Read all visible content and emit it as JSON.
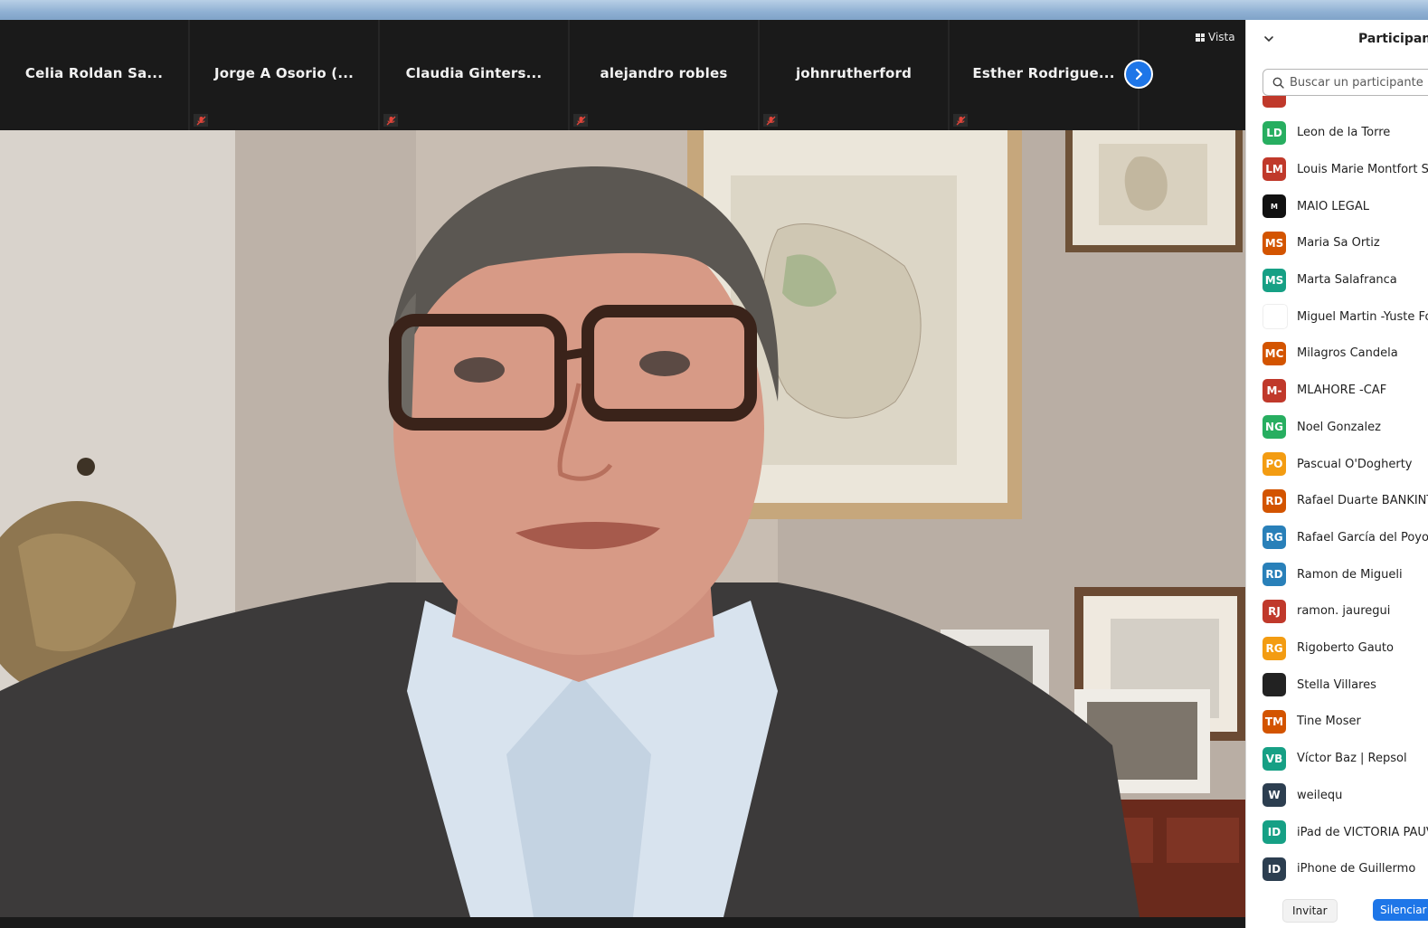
{
  "gallery": {
    "tiles": [
      {
        "name": "Celia Roldan Sa...",
        "muted": false
      },
      {
        "name": "Jorge A Osorio (...",
        "muted": true
      },
      {
        "name": "Claudia  Ginters...",
        "muted": true
      },
      {
        "name": "alejandro robles",
        "muted": true
      },
      {
        "name": "johnrutherford",
        "muted": true
      },
      {
        "name": "Esther  Rodrigue...",
        "muted": true
      }
    ],
    "next_icon": "chevron-right-icon",
    "view_label": "Vista",
    "view_icon": "grid-icon"
  },
  "panel": {
    "title": "Participant",
    "collapse_icon": "chevron-down-icon",
    "search_placeholder": "Buscar un participante",
    "search_value": "",
    "participants": [
      {
        "initials": "",
        "name": "",
        "color": "#c0392b"
      },
      {
        "initials": "LD",
        "name": "Leon de la Torre",
        "color": "#27ae60"
      },
      {
        "initials": "LM",
        "name": "Louis Marie Montfort S",
        "color": "#c0392b"
      },
      {
        "initials": "M",
        "name": "MAIO LEGAL",
        "color": "#111111"
      },
      {
        "initials": "MS",
        "name": "Maria Sa Ortiz",
        "color": "#d35400"
      },
      {
        "initials": "MS",
        "name": "Marta Salafranca",
        "color": "#16a085"
      },
      {
        "initials": "",
        "name": "Miguel Martin -Yuste Fo",
        "color": "#ffffff"
      },
      {
        "initials": "MC",
        "name": "Milagros Candela",
        "color": "#d35400"
      },
      {
        "initials": "M-",
        "name": "MLAHORE -CAF",
        "color": "#c0392b"
      },
      {
        "initials": "NG",
        "name": "Noel Gonzalez",
        "color": "#27ae60"
      },
      {
        "initials": "PO",
        "name": "Pascual O'Dogherty",
        "color": "#f39c12"
      },
      {
        "initials": "RD",
        "name": "Rafael Duarte BANKINT",
        "color": "#d35400"
      },
      {
        "initials": "RG",
        "name": "Rafael García del Poyo",
        "color": "#2980b9"
      },
      {
        "initials": "RD",
        "name": "Ramon de Migueli",
        "color": "#2980b9"
      },
      {
        "initials": "RJ",
        "name": "ramon. jauregui",
        "color": "#c0392b"
      },
      {
        "initials": "RG",
        "name": "Rigoberto Gauto",
        "color": "#f39c12"
      },
      {
        "initials": "",
        "name": "Stella Villares",
        "color": "#222222"
      },
      {
        "initials": "TM",
        "name": "Tine Moser",
        "color": "#d35400"
      },
      {
        "initials": "VB",
        "name": "Víctor Baz | Repsol",
        "color": "#16a085"
      },
      {
        "initials": "W",
        "name": "weilequ",
        "color": "#2c3e50"
      },
      {
        "initials": "ID",
        "name": "iPad de VICTORIA PAUV",
        "color": "#16a085"
      },
      {
        "initials": "ID",
        "name": "iPhone de Guillermo",
        "color": "#2c3e50"
      }
    ],
    "invite_label": "Invitar",
    "mute_all_label": "Silenciar"
  },
  "colors": {
    "accent": "#1e76e8",
    "meeting_bg": "#1a1a1a",
    "muted_icon": "#e0453a"
  }
}
